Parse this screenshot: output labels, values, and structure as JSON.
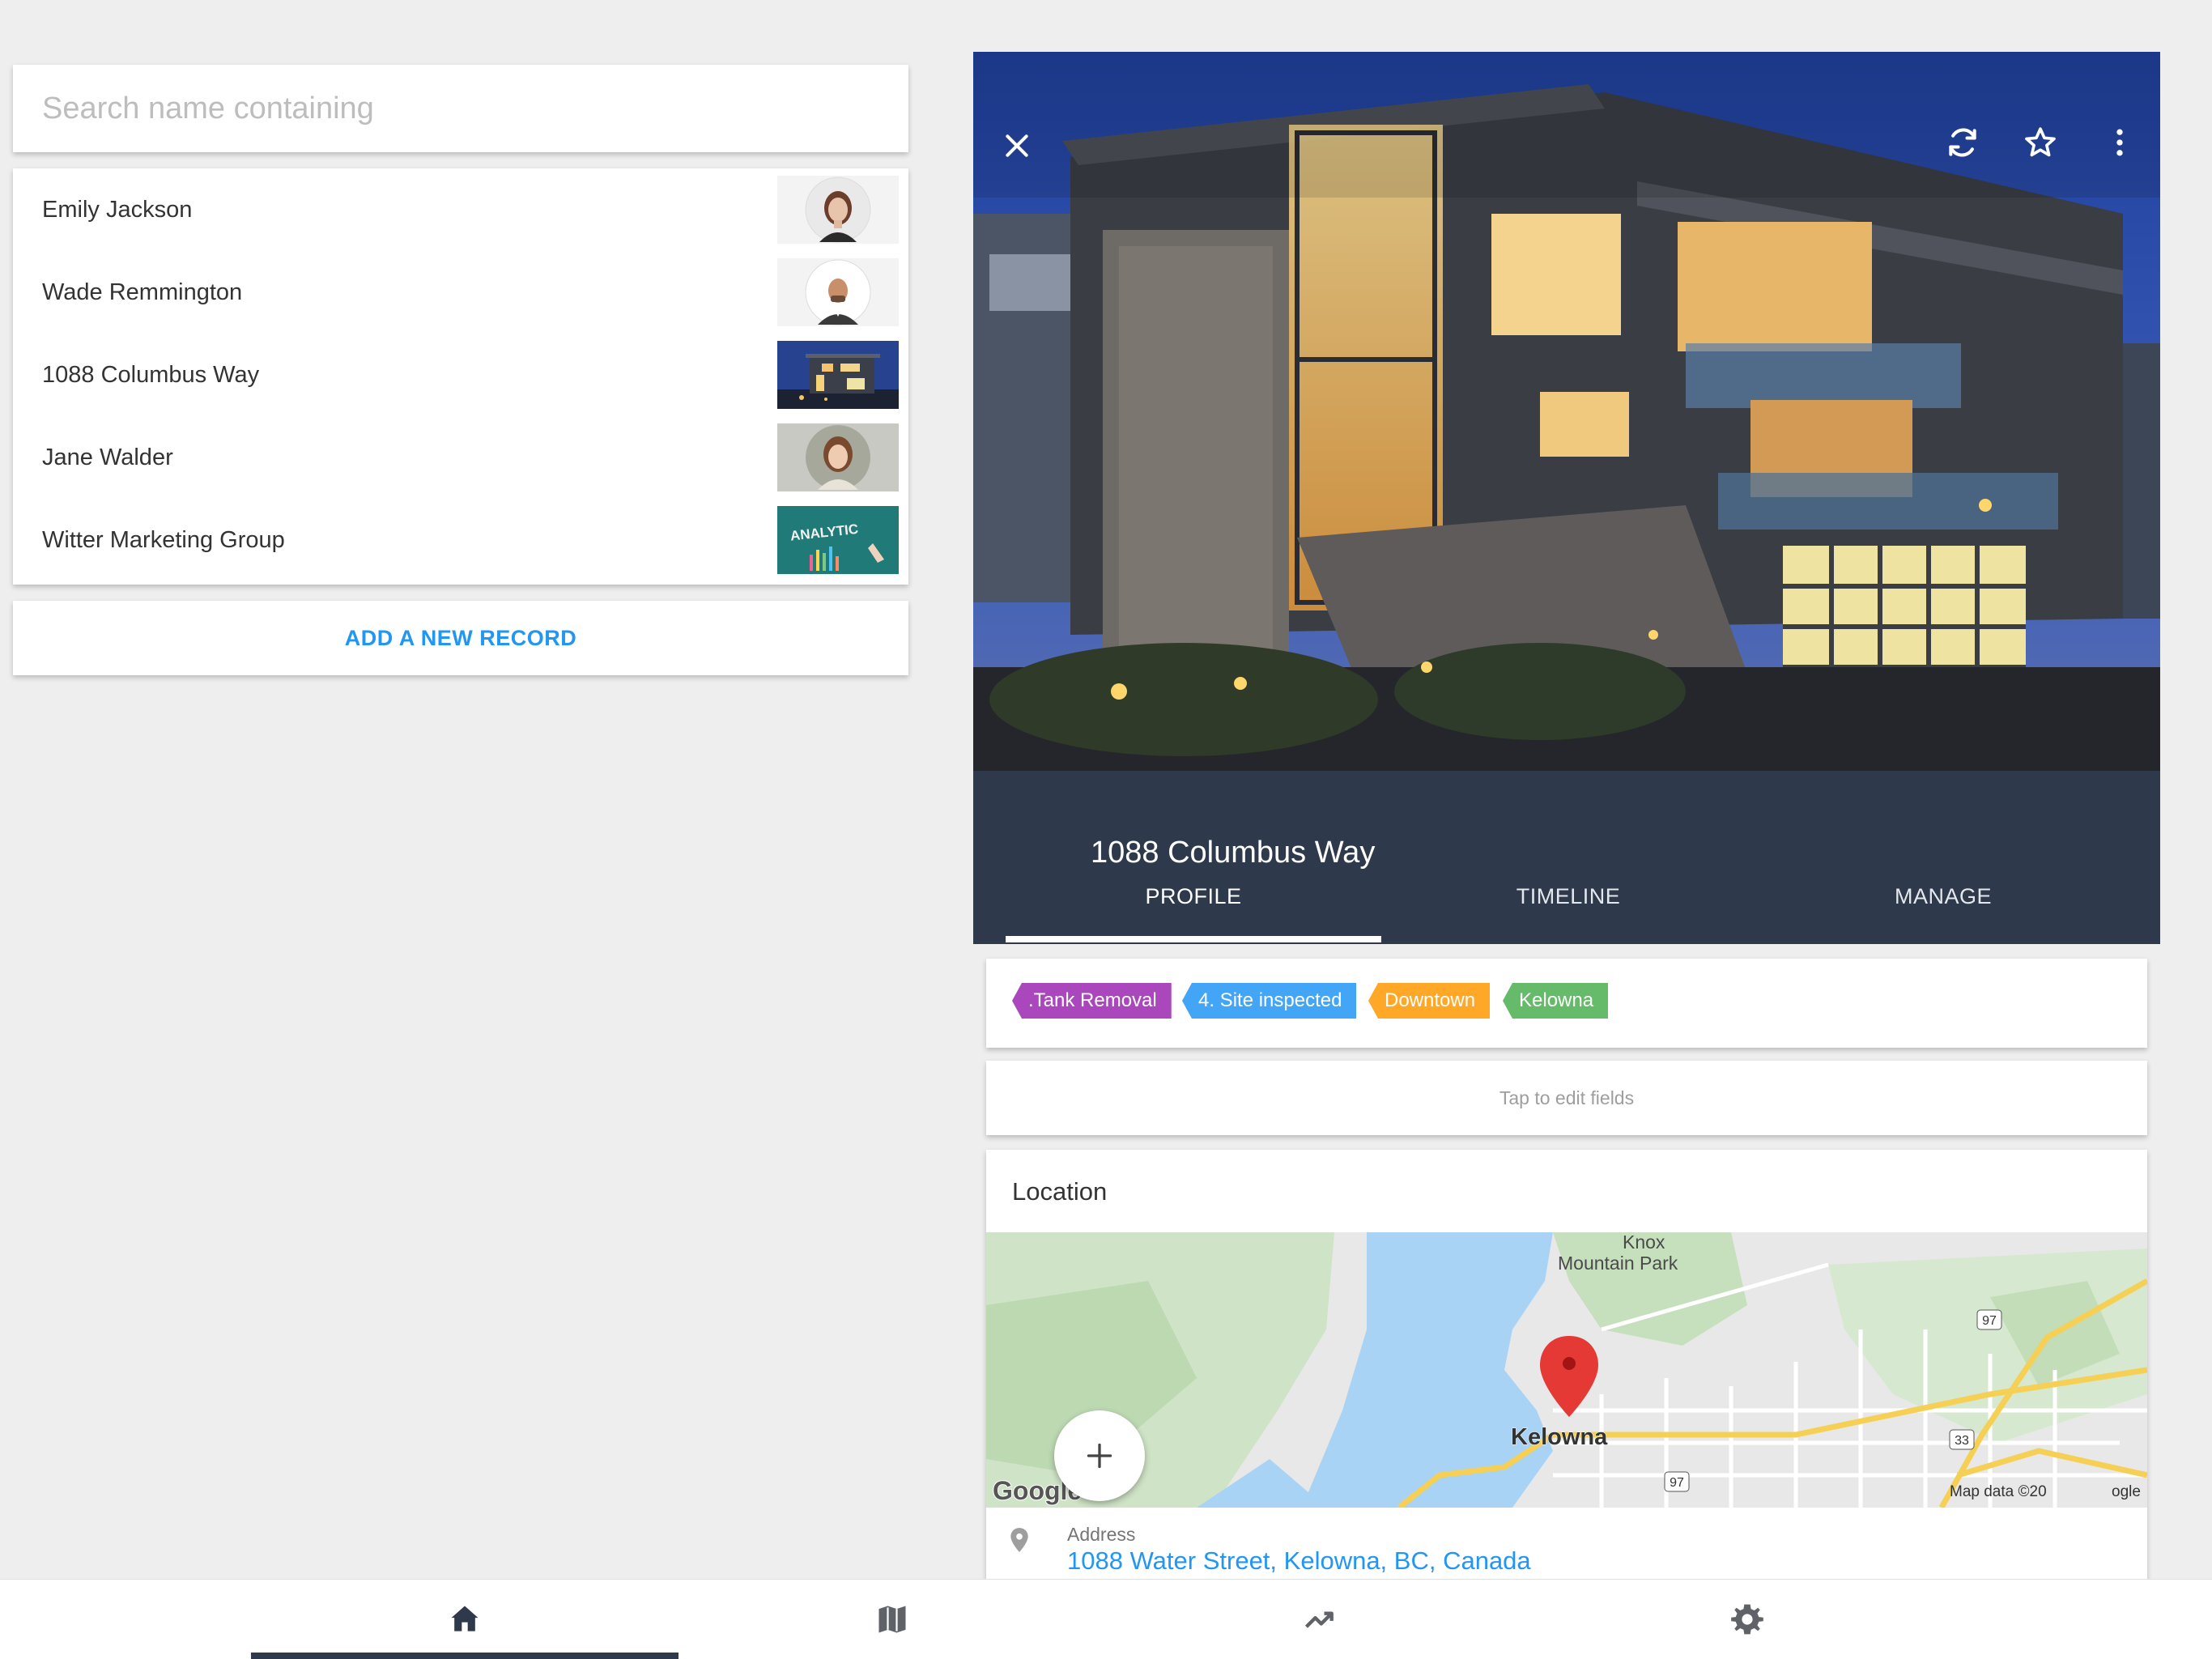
{
  "search": {
    "placeholder": "Search name containing",
    "value": ""
  },
  "records": [
    {
      "name": "Emily Jackson",
      "thumb": "avatar-woman"
    },
    {
      "name": "Wade Remmington",
      "thumb": "avatar-man"
    },
    {
      "name": "1088 Columbus Way",
      "thumb": "house-photo"
    },
    {
      "name": "Jane Walder",
      "thumb": "avatar-woman-2"
    },
    {
      "name": "Witter Marketing Group",
      "thumb": "analytics-photo",
      "thumb_text": "ANALYTIC"
    }
  ],
  "add_record": {
    "label": "ADD A NEW RECORD"
  },
  "detail": {
    "title": "1088 Columbus Way",
    "actions": [
      "close-icon",
      "sync-icon",
      "star-outline-icon",
      "more-vertical-icon"
    ],
    "tabs": [
      {
        "label": "PROFILE",
        "active": true
      },
      {
        "label": "TIMELINE",
        "active": false
      },
      {
        "label": "MANAGE",
        "active": false
      }
    ],
    "tags": [
      {
        "label": ".Tank Removal",
        "color": "#ab47bc"
      },
      {
        "label": "4. Site inspected",
        "color": "#42a5f5"
      },
      {
        "label": "Downtown",
        "color": "#ffa726"
      },
      {
        "label": "Kelowna",
        "color": "#66bb6a"
      }
    ],
    "edit_hint": "Tap to edit fields",
    "location": {
      "heading": "Location",
      "map": {
        "park_label_1": "Knox",
        "park_label_2": "Mountain Park",
        "city_label": "Kelowna",
        "route_97": "97",
        "route_33": "33",
        "attribution_logo": "Google",
        "attribution_text": "Map data ©20",
        "attribution_tail": "ogle"
      },
      "address_label": "Address",
      "address_value": "1088 Water Street, Kelowna, BC, Canada"
    }
  },
  "bottom_nav": [
    {
      "icon": "home-icon",
      "active": true
    },
    {
      "icon": "map-icon",
      "active": false
    },
    {
      "icon": "trending-up-icon",
      "active": false
    },
    {
      "icon": "settings-icon",
      "active": false
    }
  ],
  "colors": {
    "accent": "#2196f3",
    "header": "#2e3a4b",
    "background": "#eeeeee",
    "map_water": "#a9d3f5",
    "map_land": "#e8e8e8",
    "map_park": "#c9e2c2",
    "pin": "#e53935"
  }
}
